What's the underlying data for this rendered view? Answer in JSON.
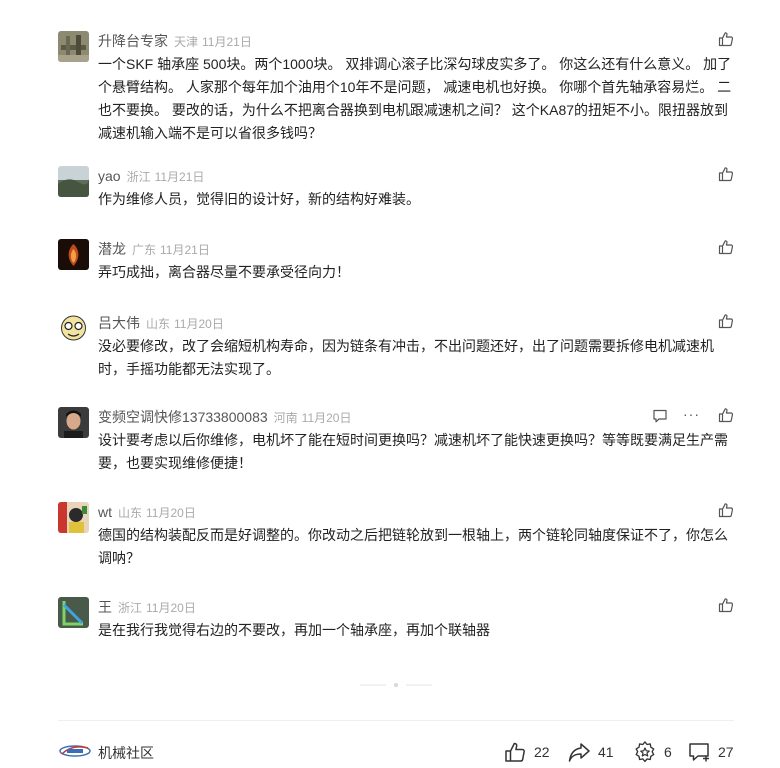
{
  "comments": [
    {
      "name": "升降台专家",
      "location": "天津",
      "date": "11月21日",
      "text": "一个SKF 轴承座 500块。两个1000块。 双排调心滚子比深勾球皮实多了。 你这么还有什么意义。 加了个悬臂结构。 人家那个每年加个油用个10年不是问题， 减速电机也好换。 你哪个首先轴承容易烂。 二也不要换。 要改的话，为什么不把离合器换到电机跟减速机之间？ 这个KA87的扭矩不小。限扭器放到减速机输入端不是可以省很多钱吗？"
    },
    {
      "name": "yao",
      "location": "浙江",
      "date": "11月21日",
      "text": "作为维修人员，觉得旧的设计好，新的结构好难装。"
    },
    {
      "name": "潜龙",
      "location": "广东",
      "date": "11月21日",
      "text": "弄巧成拙，离合器尽量不要承受径向力！"
    },
    {
      "name": "吕大伟",
      "location": "山东",
      "date": "11月20日",
      "text": "没必要修改，改了会缩短机构寿命，因为链条有冲击，不出问题还好，出了问题需要拆修电机减速机时，手摇功能都无法实现了。"
    },
    {
      "name": "变频空调快修13733800083",
      "location": "河南",
      "date": "11月20日",
      "text": "设计要考虑以后你维修，电机坏了能在短时间更换吗？减速机坏了能快速更换吗？等等既要满足生产需要，也要实现维修便捷！"
    },
    {
      "name": "wt",
      "location": "山东",
      "date": "11月20日",
      "text": "德国的结构装配反而是好调整的。你改动之后把链轮放到一根轴上，两个链轮同轴度保证不了，你怎么调呐？"
    },
    {
      "name": "王",
      "location": "浙江",
      "date": "11月20日",
      "text": "是在我行我觉得右边的不要改，再加一个轴承座，再加个联轴器"
    }
  ],
  "footer": {
    "brand": "机械社区",
    "likes": "22",
    "shares": "41",
    "favorites": "6",
    "comments": "27"
  }
}
